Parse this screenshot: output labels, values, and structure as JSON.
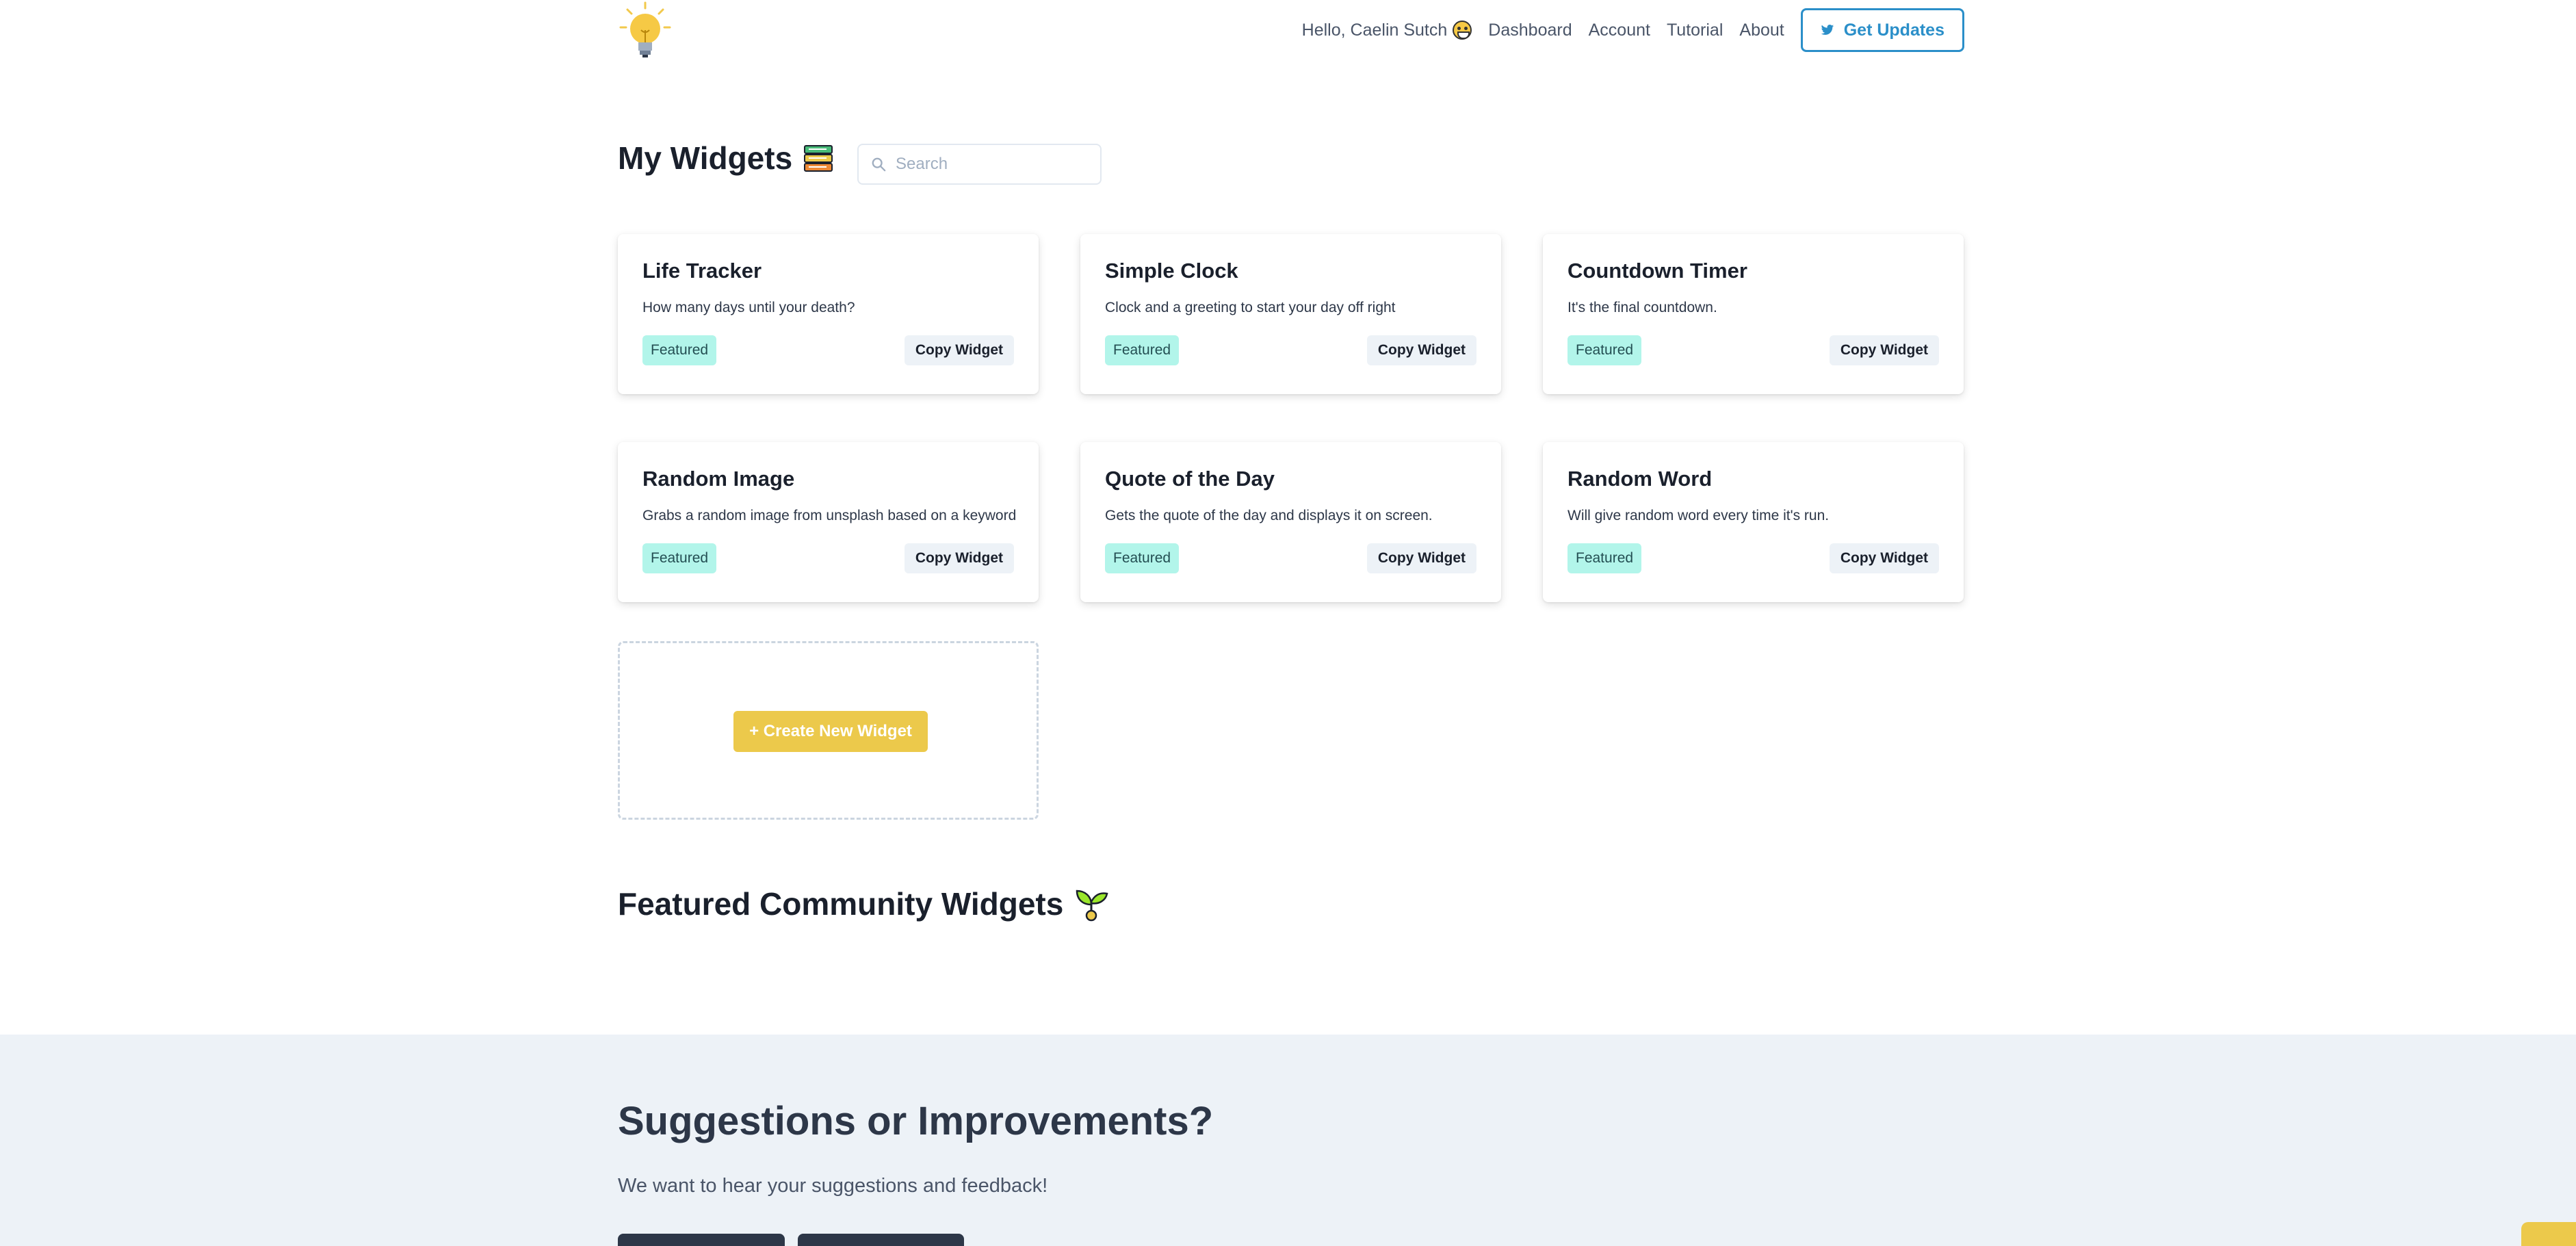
{
  "header": {
    "greeting": "Hello, Caelin Sutch",
    "nav": [
      "Dashboard",
      "Account",
      "Tutorial",
      "About"
    ],
    "updates_button": "Get Updates",
    "logo_icon": "lightbulb-icon",
    "updates_icon": "twitter-icon",
    "accent_color": "#2b8fc9"
  },
  "my_widgets": {
    "title": "My Widgets",
    "title_icon": "books-icon",
    "search_placeholder": "Search",
    "cards": [
      {
        "title": "Life Tracker",
        "description": "How many days until your death?",
        "badge": "Featured",
        "action": "Copy Widget"
      },
      {
        "title": "Simple Clock",
        "description": "Clock and a greeting to start your day off right",
        "badge": "Featured",
        "action": "Copy Widget"
      },
      {
        "title": "Countdown Timer",
        "description": "It's the final countdown.",
        "badge": "Featured",
        "action": "Copy Widget"
      },
      {
        "title": "Random Image",
        "description": "Grabs a random image from unsplash based on a keyword",
        "badge": "Featured",
        "action": "Copy Widget"
      },
      {
        "title": "Quote of the Day",
        "description": "Gets the quote of the day and displays it on screen.",
        "badge": "Featured",
        "action": "Copy Widget"
      },
      {
        "title": "Random Word",
        "description": "Will give random word every time it's run.",
        "badge": "Featured",
        "action": "Copy Widget"
      }
    ],
    "create_button": "+ Create New Widget"
  },
  "featured": {
    "title": "Featured Community Widgets",
    "title_icon": "seedling-icon"
  },
  "suggestions": {
    "title": "Suggestions or Improvements?",
    "subtitle": "We want to hear your suggestions and feedback!"
  },
  "colors": {
    "badge_bg": "#b2f5ea",
    "create_button": "#ecc94b",
    "footer_bg": "#edf2f7"
  }
}
